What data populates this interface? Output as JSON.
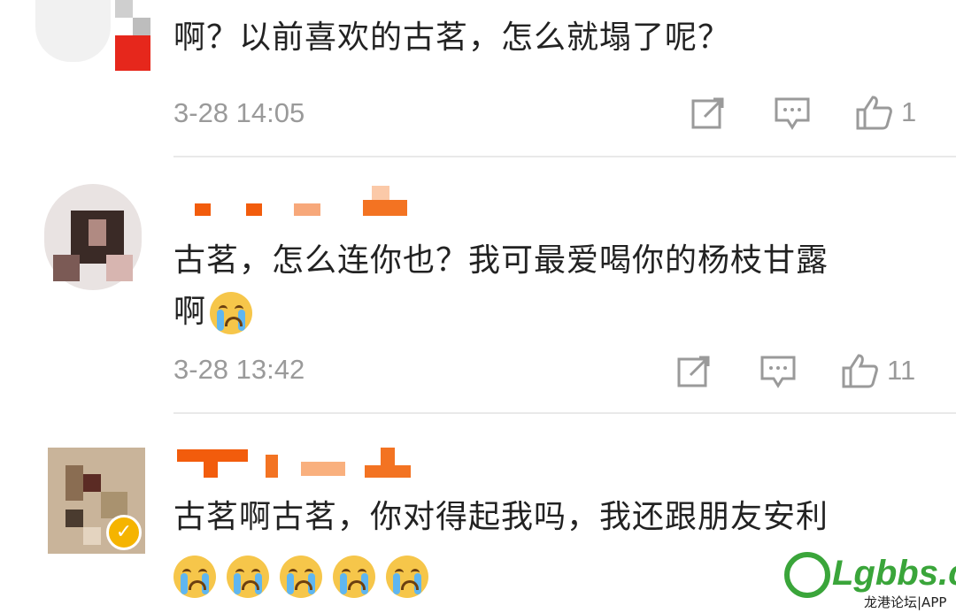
{
  "comments": [
    {
      "text": "啊？以前喜欢的古茗，怎么就塌了呢？",
      "time": "3-28 14:05",
      "likes": "1"
    },
    {
      "text_line1": "古茗，怎么连你也？我可最爱喝你的杨枝甘露",
      "text_line2": "啊",
      "time": "3-28 13:42",
      "likes": "11"
    },
    {
      "text": "古茗啊古茗，你对得起我吗，我还跟朋友安利"
    }
  ],
  "watermark": {
    "brand": "Lgbbs.cn",
    "sub": "龙港论坛|APP"
  },
  "colors": {
    "meta": "#9a9a9a",
    "text": "#222222",
    "watermark": "#3aa53a",
    "verified": "#f5b400"
  }
}
